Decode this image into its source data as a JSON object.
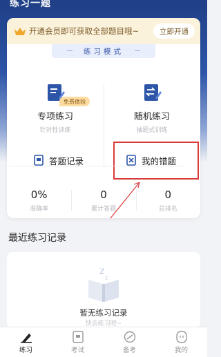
{
  "header": {
    "title": "练习一题"
  },
  "vip": {
    "text": "开通会员即可获取全部题目哦~",
    "button": "立即开通"
  },
  "mode_tag": "练习模式",
  "modes": [
    {
      "label": "专项练习",
      "sub": "针对性训练",
      "icon": "doc-pen-icon"
    },
    {
      "label": "随机练习",
      "sub": "抽题式训练",
      "icon": "shuffle-doc-icon"
    }
  ],
  "free_badge": "免费体验",
  "actions": [
    {
      "label": "答题记录",
      "icon": "record-icon"
    },
    {
      "label": "我的错题",
      "icon": "wrong-questions-icon"
    }
  ],
  "stats": [
    {
      "value": "0%",
      "label": "准确率"
    },
    {
      "value": "0",
      "label": "累计答题"
    },
    {
      "value": "0",
      "label": "总排名"
    }
  ],
  "recent": {
    "title": "最近练习记录",
    "empty_text": "暂无练习记录",
    "empty_sub": "快去练习吧~"
  },
  "tabs": [
    {
      "label": "练习",
      "icon": "pen-icon",
      "active": true
    },
    {
      "label": "考试",
      "icon": "exam-icon",
      "active": false
    },
    {
      "label": "备考",
      "icon": "compass-icon",
      "active": false
    },
    {
      "label": "我的",
      "icon": "profile-icon",
      "active": false
    }
  ],
  "colors": {
    "brand": "#2d55a8",
    "highlight": "#d83a3a",
    "vip_bg": "#fbf2dc"
  }
}
